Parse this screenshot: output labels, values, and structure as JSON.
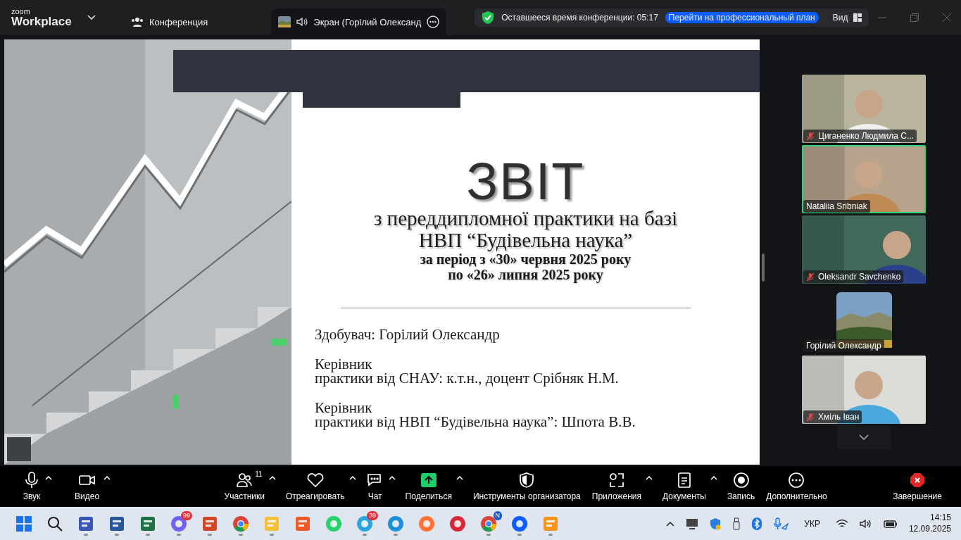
{
  "app": {
    "logo_top": "zoom",
    "logo_bottom": "Workplace"
  },
  "tabs": [
    {
      "label": "Конференция",
      "kind": "meeting",
      "selected": false
    },
    {
      "label": "Экран (Горілий Олександ",
      "kind": "screen",
      "selected": true
    }
  ],
  "banner": {
    "text": "Оставшееся время конференции: 05:17",
    "link": "Перейти на профессиональный план",
    "view": "Вид"
  },
  "slide": {
    "title": "ЗВІТ",
    "subtitle": [
      "з переддипломної практики на базі",
      "НВП “Будівельна наука”"
    ],
    "period": [
      "за період з «30» червня 2025 року",
      "по «26» липня 2025 року"
    ],
    "details": [
      {
        "lines": [
          "Здобувач: Горілий Олександр"
        ]
      },
      {
        "lines": [
          "Керівник",
          "практики від СНАУ: к.т.н., доцент Срібняк Н.М."
        ]
      },
      {
        "lines": [
          "Керівник",
          "практики від НВП “Будівельна наука”: Шпота В.В."
        ]
      }
    ]
  },
  "participants": [
    {
      "name": "Циганенко Людмила С...",
      "kind": "video",
      "muted": true,
      "speaking": false
    },
    {
      "name": "Nataliia Sribniak",
      "kind": "video",
      "muted": false,
      "speaking": true
    },
    {
      "name": "Oleksandr Savchenko",
      "kind": "video",
      "muted": true,
      "speaking": false
    },
    {
      "name": "Горілий Олександр",
      "kind": "avatar",
      "muted": false,
      "speaking": false
    },
    {
      "name": "Хміль Іван",
      "kind": "video",
      "muted": true,
      "speaking": false
    }
  ],
  "toolbar": [
    {
      "label": "Звук",
      "kind": "mic",
      "caret": true
    },
    {
      "label": "Видео",
      "kind": "video",
      "caret": true
    },
    {
      "label": "Участники",
      "kind": "people",
      "caret": true,
      "count": "11"
    },
    {
      "label": "Отреагировать",
      "kind": "heart",
      "caret": true
    },
    {
      "label": "Чат",
      "kind": "chat",
      "caret": true
    },
    {
      "label": "Поделиться",
      "kind": "share",
      "caret": true
    },
    {
      "label": "Инструменты организатора",
      "kind": "shield",
      "caret": false
    },
    {
      "label": "Приложения",
      "kind": "apps",
      "caret": true
    },
    {
      "label": "Документы",
      "kind": "docs",
      "caret": true
    },
    {
      "label": "Запись",
      "kind": "record",
      "caret": false
    },
    {
      "label": "Дополнительно",
      "kind": "more",
      "caret": false
    },
    {
      "label": "Завершение",
      "kind": "end",
      "caret": false
    }
  ],
  "taskbar": {
    "apps": [
      {
        "kind": "windows",
        "running": false
      },
      {
        "kind": "search",
        "running": false
      },
      {
        "kind": "floppy",
        "running": true
      },
      {
        "kind": "word",
        "running": true
      },
      {
        "kind": "excel",
        "running": true
      },
      {
        "kind": "viber",
        "running": true,
        "badge": "99"
      },
      {
        "kind": "powerpoint",
        "running": true
      },
      {
        "kind": "chrome",
        "running": true
      },
      {
        "kind": "folder",
        "running": true
      },
      {
        "kind": "orange",
        "running": false
      },
      {
        "kind": "whatsapp",
        "running": false
      },
      {
        "kind": "telegram",
        "running": true,
        "badge": "39"
      },
      {
        "kind": "edge",
        "running": true
      },
      {
        "kind": "firefox",
        "running": false
      },
      {
        "kind": "red",
        "running": false
      },
      {
        "kind": "chrome",
        "running": true,
        "badge": "N"
      },
      {
        "kind": "zoom",
        "running": true
      },
      {
        "kind": "pdf",
        "running": true
      }
    ],
    "language": "УКР",
    "time": "14:15",
    "date": "12.09.2025"
  }
}
